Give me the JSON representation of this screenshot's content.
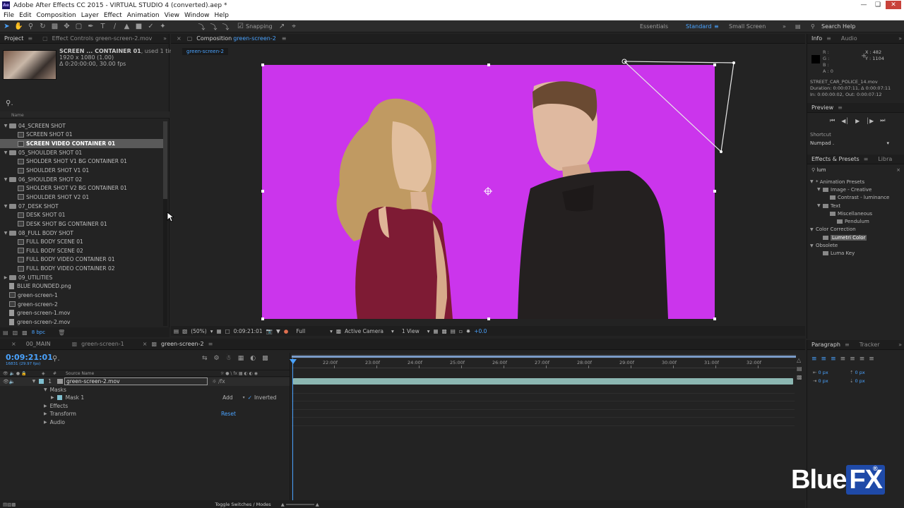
{
  "window": {
    "title": "Adobe After Effects CC 2015 - VIRTUAL STUDIO 4 (converted).aep *",
    "logo": "Ae"
  },
  "menu": [
    "File",
    "Edit",
    "Composition",
    "Layer",
    "Effect",
    "Animation",
    "View",
    "Window",
    "Help"
  ],
  "toolbar": {
    "snapping": "Snapping",
    "workspaces": [
      "Essentials",
      "Standard",
      "Small Screen"
    ],
    "active_workspace": "Standard",
    "search_help": "Search Help"
  },
  "project": {
    "tab_project": "Project",
    "tab_effect_controls": "Effect Controls green-screen-2.mov",
    "selected_name": "SCREEN ... CONTAINER 01",
    "used": ", used 1 time",
    "dims": "1920 x 1080 (1.00)",
    "duration": "Δ 0:20:00:00, 30.00 fps",
    "search_placeholder": "",
    "col_name": "Name",
    "bpc": "8 bpc",
    "items": [
      {
        "type": "folder",
        "depth": 0,
        "label": "04_SCREEN SHOT"
      },
      {
        "type": "comp",
        "depth": 1,
        "label": "SCREEN SHOT 01"
      },
      {
        "type": "comp",
        "depth": 1,
        "label": "SCREEN VIDEO CONTAINER 01",
        "selected": true
      },
      {
        "type": "folder",
        "depth": 0,
        "label": "05_SHOULDER SHOT 01"
      },
      {
        "type": "comp",
        "depth": 1,
        "label": "SHOLDER SHOT V1 BG CONTAINER 01"
      },
      {
        "type": "comp",
        "depth": 1,
        "label": "SHOULDER SHOT V1 01"
      },
      {
        "type": "folder",
        "depth": 0,
        "label": "06_SHOULDER SHOT 02"
      },
      {
        "type": "comp",
        "depth": 1,
        "label": "SHOLDER SHOT V2 BG CONTAINER 01"
      },
      {
        "type": "comp",
        "depth": 1,
        "label": "SHOULDER SHOT V2 01"
      },
      {
        "type": "folder",
        "depth": 0,
        "label": "07_DESK SHOT"
      },
      {
        "type": "comp",
        "depth": 1,
        "label": "DESK SHOT 01"
      },
      {
        "type": "comp",
        "depth": 1,
        "label": "DESK SHOT BG CONTAINER 01"
      },
      {
        "type": "folder",
        "depth": 0,
        "label": "08_FULL BODY SHOT"
      },
      {
        "type": "comp",
        "depth": 1,
        "label": "FULL BODY SCENE 01"
      },
      {
        "type": "comp",
        "depth": 1,
        "label": "FULL BODY SCENE 02"
      },
      {
        "type": "comp",
        "depth": 1,
        "label": "FULL BODY VIDEO CONTAINER 01"
      },
      {
        "type": "comp",
        "depth": 1,
        "label": "FULL BODY VIDEO CONTAINER 02"
      },
      {
        "type": "folder-closed",
        "depth": 0,
        "label": "09_UTILITIES"
      },
      {
        "type": "file",
        "depth": 0,
        "label": "BLUE ROUNDED.png"
      },
      {
        "type": "comp",
        "depth": 0,
        "label": "green-screen-1"
      },
      {
        "type": "comp",
        "depth": 0,
        "label": "green-screen-2"
      },
      {
        "type": "file",
        "depth": 0,
        "label": "green-screen-1.mov"
      },
      {
        "type": "file",
        "depth": 0,
        "label": "green-screen-2.mov"
      }
    ]
  },
  "composition": {
    "tab_label": "Composition",
    "tab_comp": "green-screen-2",
    "sub_tab": "green-screen-2",
    "zoom": "(50%)",
    "timecode": "0:09:21:01",
    "resolution": "Full",
    "camera": "Active Camera",
    "views": "1 View",
    "exposure": "+0.0",
    "bg_color": "#cb35ec"
  },
  "info": {
    "tab_info": "Info",
    "tab_audio": "Audio",
    "r": "R :",
    "g": "G :",
    "b": "B :",
    "a": "A : 0",
    "x": "X : 482",
    "y": "Y : 1104",
    "file": "STREET_CAR_POLICE_14.mov",
    "duration": "Duration: 0:00:07:11, Δ 0:00:07:11",
    "inout": "In: 0:00:00:02, Out: 0:00:07:12"
  },
  "preview": {
    "title": "Preview",
    "shortcut_label": "Shortcut",
    "shortcut_value": "Numpad ."
  },
  "effects": {
    "tab": "Effects & Presets",
    "tab2": "Libra",
    "search": "lum",
    "tree": [
      {
        "depth": 0,
        "label": "* Animation Presets"
      },
      {
        "depth": 1,
        "label": "Image - Creative"
      },
      {
        "depth": 2,
        "label": "Contrast - luminance"
      },
      {
        "depth": 1,
        "label": "Text"
      },
      {
        "depth": 2,
        "label": "Miscellaneous"
      },
      {
        "depth": 3,
        "label": "Pendulum"
      },
      {
        "depth": 0,
        "label": "Color Correction"
      },
      {
        "depth": 1,
        "label": "Lumetri Color",
        "selected": true
      },
      {
        "depth": 0,
        "label": "Obsolete"
      },
      {
        "depth": 1,
        "label": "Luma Key"
      }
    ]
  },
  "paragraph": {
    "tab": "Paragraph",
    "tab2": "Tracker",
    "px": "0 px"
  },
  "timeline": {
    "tabs": [
      "00_MAIN",
      "green-screen-1",
      "green-screen-2"
    ],
    "active_tab": "green-screen-2",
    "timecode": "0:09:21:01",
    "frames": "16831 (29.97 fps)",
    "col_source": "Source Name",
    "layer_num": "1",
    "layer_name": "green-screen-2.mov",
    "masks": "Masks",
    "mask1": "Mask 1",
    "mask_mode": "Add",
    "inverted": "Inverted",
    "effects": "Effects",
    "transform": "Transform",
    "reset": "Reset",
    "audio": "Audio",
    "toggle": "Toggle Switches / Modes",
    "ruler": [
      "22:00f",
      "23:00f",
      "24:00f",
      "25:00f",
      "26:00f",
      "27:00f",
      "28:00f",
      "29:00f",
      "30:00f",
      "31:00f",
      "32:00f"
    ]
  },
  "watermark": {
    "text_a": "Blue",
    "text_b": "FX",
    "mark": "®"
  }
}
